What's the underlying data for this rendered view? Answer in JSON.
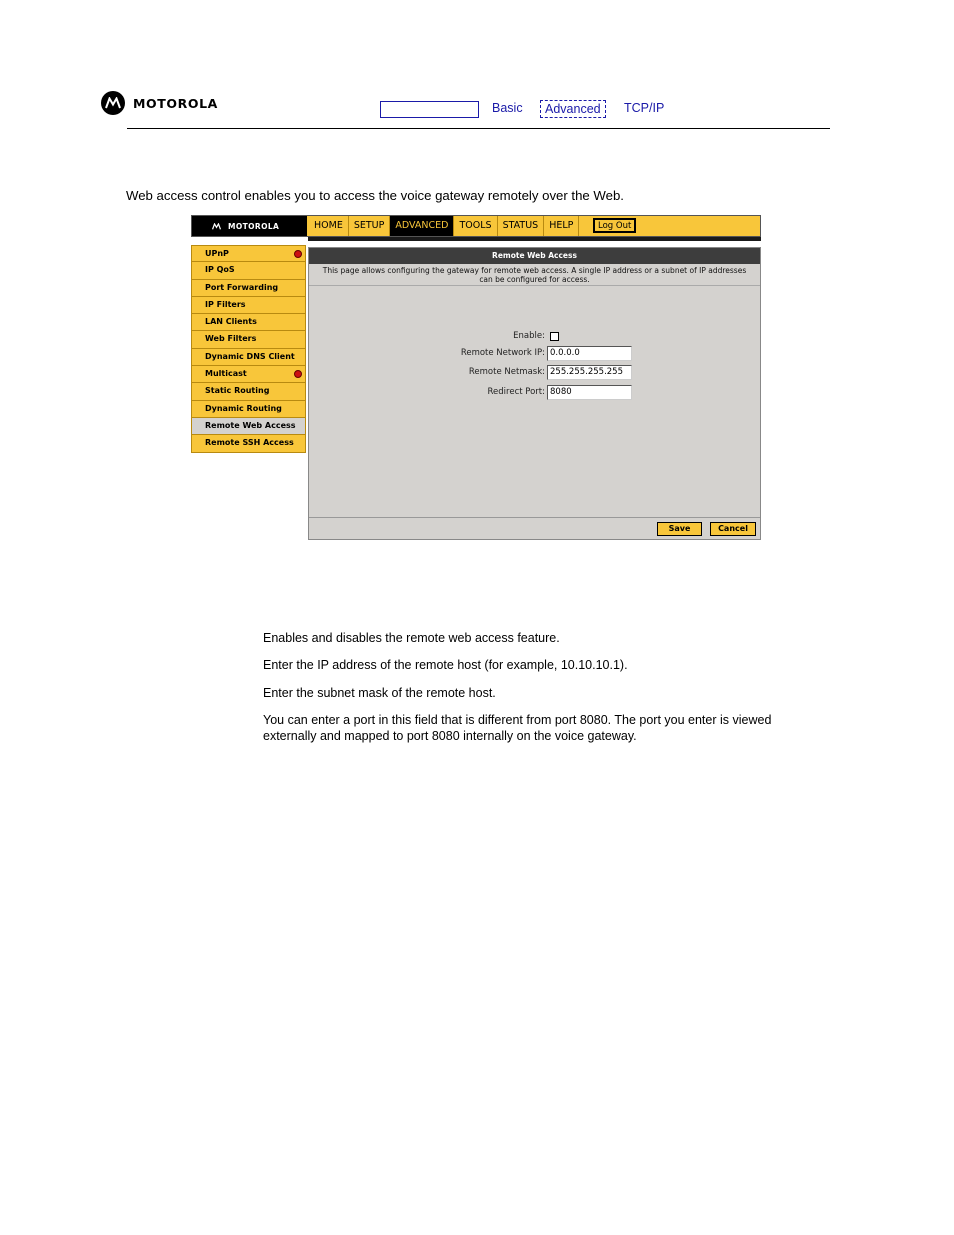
{
  "doc_header": {
    "brand": "MOTOROLA",
    "nav": {
      "basic": "Basic",
      "advanced": "Advanced",
      "tcpip": "TCP/IP"
    }
  },
  "intro_text": "Web access control enables you to access the voice gateway remotely over the Web.",
  "app": {
    "brand": "MOTOROLA",
    "tabs": [
      "HOME",
      "SETUP",
      "ADVANCED",
      "TOOLS",
      "STATUS",
      "HELP"
    ],
    "active_tab": "ADVANCED",
    "logout_label": "Log Out",
    "sidebar": [
      {
        "label": "UPnP",
        "alert": true
      },
      {
        "label": "IP QoS",
        "alert": false
      },
      {
        "label": "Port Forwarding",
        "alert": false
      },
      {
        "label": "IP Filters",
        "alert": false
      },
      {
        "label": "LAN Clients",
        "alert": false
      },
      {
        "label": "Web Filters",
        "alert": false
      },
      {
        "label": "Dynamic DNS Client",
        "alert": false
      },
      {
        "label": "Multicast",
        "alert": true
      },
      {
        "label": "Static Routing",
        "alert": false
      },
      {
        "label": "Dynamic Routing",
        "alert": false
      },
      {
        "label": "Remote Web Access",
        "alert": false
      },
      {
        "label": "Remote SSH Access",
        "alert": false
      }
    ],
    "active_sidebar": "Remote Web Access",
    "panel": {
      "title": "Remote Web Access",
      "description": "This page allows configuring the gateway for remote web access. A single IP address or a subnet of IP addresses can be configured for access.",
      "enable_label": "Enable:",
      "enable_checked": false,
      "network_ip_label": "Remote Network IP:",
      "network_ip_value": "0.0.0.0",
      "netmask_label": "Remote Netmask:",
      "netmask_value": "255.255.255.255",
      "port_label": "Redirect Port:",
      "port_value": "8080",
      "save_label": "Save",
      "cancel_label": "Cancel"
    },
    "colors": {
      "accent": "#f8c63a",
      "panel_bg": "#d4d2cf",
      "title_bar": "#3d3d3d"
    }
  },
  "descriptions": [
    "Enables and disables the remote web access feature.",
    "Enter the IP address of the remote host (for example, 10.10.10.1).",
    "Enter the subnet mask of the remote host.",
    "You can enter a port in this field that is different from port 8080. The port you enter is viewed externally and mapped to port 8080 internally on the voice gateway."
  ]
}
